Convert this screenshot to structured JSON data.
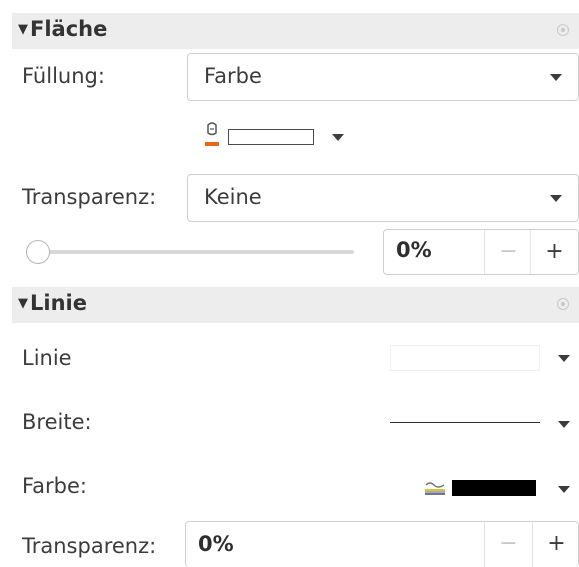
{
  "flaeche": {
    "title": "Fläche",
    "fuellung_label": "Füllung:",
    "fuellung_value": "Farbe",
    "fill_color": "#ffffff",
    "transparenz_label": "Transparenz:",
    "transparenz_value": "Keine",
    "slider_level": 0,
    "percent_value": "0%",
    "minus": "−",
    "plus": "+"
  },
  "linie": {
    "title": "Linie",
    "linie_label": "Linie",
    "breite_label": "Breite:",
    "farbe_label": "Farbe:",
    "line_color": "#000000",
    "transparenz_label": "Transparenz:",
    "percent_value": "0%",
    "minus": "−",
    "plus": "+"
  },
  "icons": {
    "collapse": "triangle-down-icon",
    "more_options": "gear-icon",
    "fill_bucket": "paint-bucket-icon",
    "line_color": "line-color-icon"
  }
}
